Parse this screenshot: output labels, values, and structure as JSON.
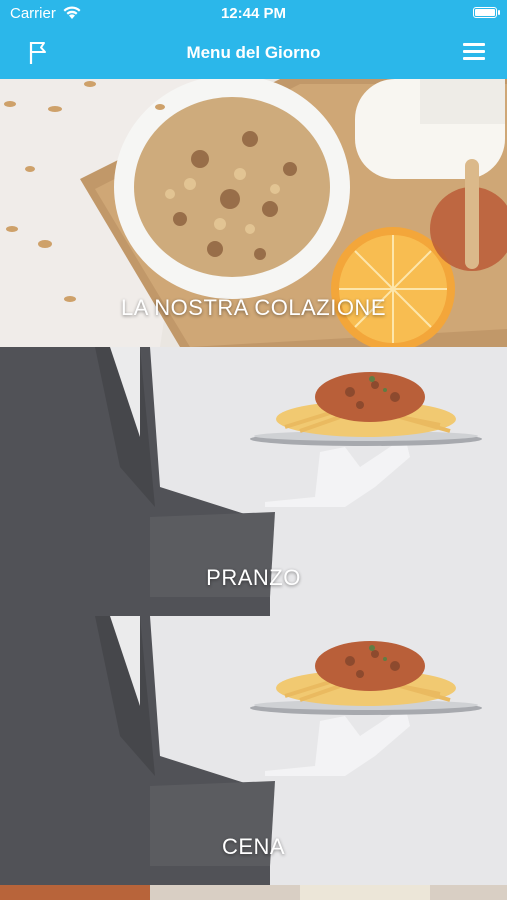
{
  "status_bar": {
    "carrier": "Carrier",
    "time": "12:44 PM",
    "wifi_icon": "wifi-icon",
    "battery_icon": "battery-icon"
  },
  "nav": {
    "title": "Menu del Giorno",
    "left_icon": "flag-icon",
    "right_icon": "hamburger-menu-icon",
    "bar_color": "#2bb7ea"
  },
  "sections": [
    {
      "label": "LA NOSTRA COLAZIONE",
      "image": "breakfast-image"
    },
    {
      "label": "PRANZO",
      "image": "lunch-image"
    },
    {
      "label": "CENA",
      "image": "dinner-image"
    }
  ]
}
